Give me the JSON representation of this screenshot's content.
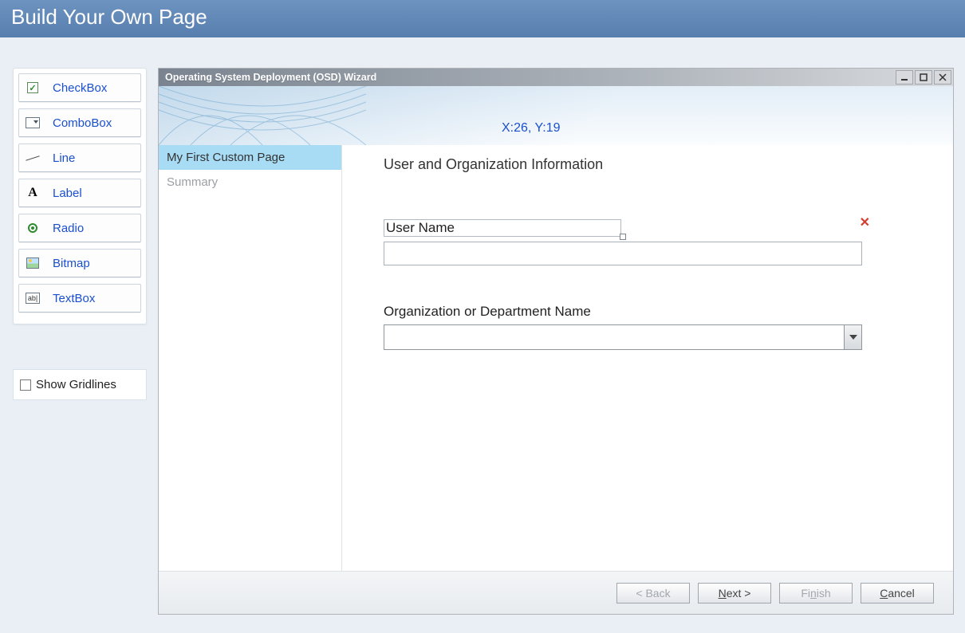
{
  "header": {
    "title": "Build Your Own Page"
  },
  "toolbox": {
    "items": [
      {
        "label": "CheckBox"
      },
      {
        "label": "ComboBox"
      },
      {
        "label": "Line"
      },
      {
        "label": "Label"
      },
      {
        "label": "Radio"
      },
      {
        "label": "Bitmap"
      },
      {
        "label": "TextBox"
      }
    ]
  },
  "show_gridlines": {
    "label": "Show Gridlines",
    "checked": false
  },
  "wizard": {
    "title": "Operating System Deployment (OSD) Wizard",
    "coord": "X:26, Y:19",
    "nav": [
      {
        "label": "My First Custom Page",
        "active": true
      },
      {
        "label": "Summary",
        "active": false
      }
    ],
    "content": {
      "heading": "User and Organization Information",
      "user_name_label": "User Name",
      "user_name_value": "",
      "org_label": "Organization or Department Name",
      "org_value": ""
    },
    "footer": {
      "back": "< Back",
      "next": "Next >",
      "finish": "Finish",
      "cancel": "Cancel"
    }
  }
}
